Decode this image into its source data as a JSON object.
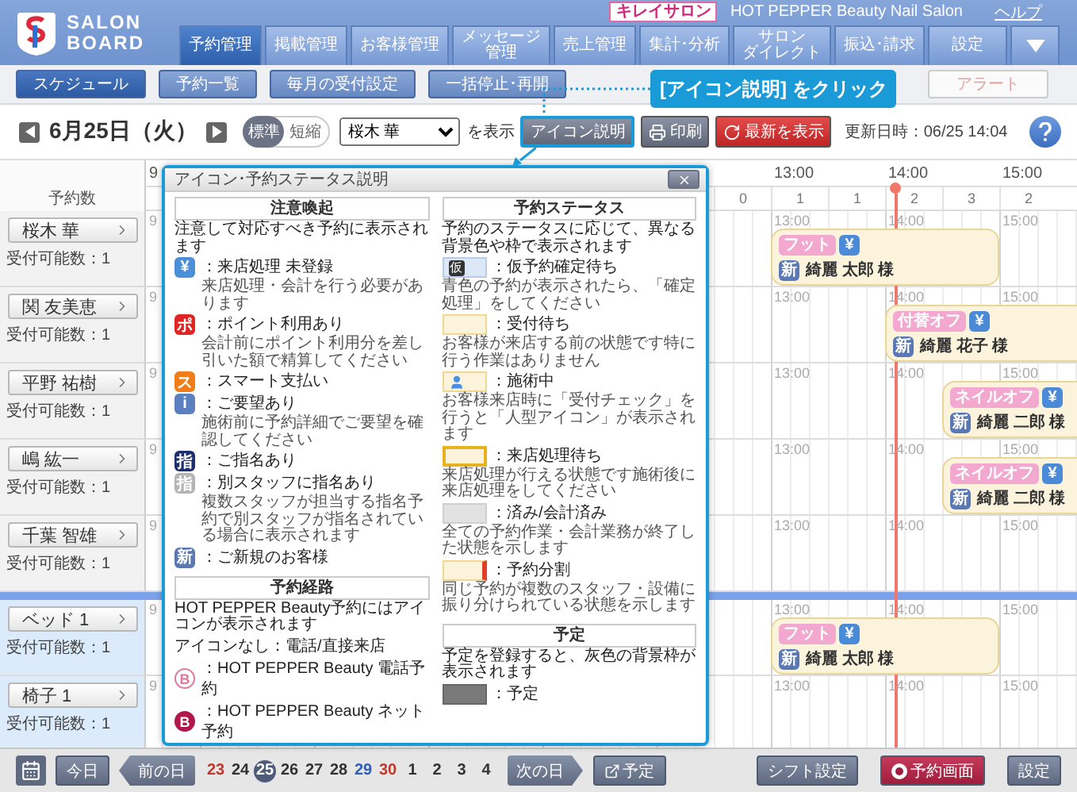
{
  "header": {
    "logo": {
      "line1": "SALON",
      "line2": "BOARD"
    },
    "site_badge": "キレイサロン",
    "salon_name": "HOT PEPPER Beauty Nail Salon",
    "help_link": "ヘルプ",
    "tabs": [
      {
        "lines": [
          "予約管理"
        ],
        "selected": true
      },
      {
        "lines": [
          "掲載管理"
        ],
        "selected": false
      },
      {
        "lines": [
          "お客様管理"
        ],
        "selected": false
      },
      {
        "lines": [
          "メッセージ",
          "管理"
        ],
        "selected": false
      },
      {
        "lines": [
          "売上管理"
        ],
        "selected": false
      },
      {
        "lines": [
          "集計･分析"
        ],
        "selected": false
      },
      {
        "lines": [
          "サロン",
          "ダイレクト"
        ],
        "selected": false
      },
      {
        "lines": [
          "振込･請求"
        ],
        "selected": false
      },
      {
        "lines": [
          "設定"
        ],
        "selected": false
      }
    ]
  },
  "subnav": {
    "buttons": [
      {
        "label": "スケジュール",
        "selected": true
      },
      {
        "label": "予約一覧",
        "selected": false
      },
      {
        "label": "毎月の受付設定",
        "selected": false
      },
      {
        "label": "一括停止･再開",
        "selected": false
      }
    ],
    "alert_button": {
      "label": "アラート",
      "disabled": true
    }
  },
  "callout": {
    "text": "[アイコン説明] をクリック"
  },
  "toolbar": {
    "date": "6月25日（火）",
    "view_toggle": [
      {
        "label": "標準",
        "selected": true
      },
      {
        "label": "短縮",
        "selected": false
      }
    ],
    "staff_select": "桜木 華",
    "select_suffix": "を表示",
    "buttons": [
      {
        "label": "アイコン説明",
        "kind": "legend",
        "highlighted": true
      },
      {
        "label": "印刷",
        "kind": "print",
        "highlighted": false
      },
      {
        "label": "最新を表示",
        "kind": "refresh",
        "highlighted": false
      }
    ],
    "updated": "更新日時：06/25 14:04"
  },
  "schedule": {
    "count_header": "予約数",
    "time_labels": [
      "9",
      "13:00",
      "14:00",
      "15:00"
    ],
    "slot_counts": [
      "0",
      "1",
      "1",
      "2",
      "3",
      "2"
    ],
    "now_marker": {
      "kind": "five_past_two"
    },
    "rows": [
      {
        "name": "桜木 華",
        "kind": "staff",
        "capacity": "受付可能数：1",
        "time_labels": [
          "9",
          "13:00",
          "14:00",
          "15:00"
        ],
        "bookings": [
          {
            "kind": "one_to_three",
            "menu": "フット",
            "payment_badge": "¥",
            "new_badge": "新",
            "customer": "綺麗 太郎 様"
          }
        ]
      },
      {
        "name": "関 友美恵",
        "kind": "staff",
        "capacity": "受付可能数：1",
        "time_labels": [
          "9",
          "13:00",
          "14:00",
          "15:00"
        ],
        "bookings": [
          {
            "kind": "two_to_four",
            "menu": "付替オフ",
            "payment_badge": "¥",
            "new_badge": "新",
            "customer": "綺麗 花子 様"
          }
        ]
      },
      {
        "name": "平野 祐樹",
        "kind": "staff",
        "capacity": "受付可能数：1",
        "time_labels": [
          "9",
          "13:00",
          "14:00",
          "15:00"
        ],
        "bookings": [
          {
            "kind": "half_two_to_four",
            "menu": "ネイルオフ",
            "payment_badge": "¥",
            "new_badge": "新",
            "customer": "綺麗 二郎 様"
          }
        ]
      },
      {
        "name": "嶋 紘一",
        "kind": "staff",
        "capacity": "受付可能数：1",
        "time_labels": [
          "9",
          "13:00",
          "14:00",
          "15:00"
        ],
        "bookings": [
          {
            "kind": "half_two_to_four",
            "menu": "ネイルオフ",
            "payment_badge": "¥",
            "new_badge": "新",
            "customer": "綺麗 二郎 様"
          }
        ]
      },
      {
        "name": "千葉 智雄",
        "kind": "staff",
        "capacity": "受付可能数：1",
        "time_labels": [
          "9",
          "13:00",
          "14:00",
          "15:00"
        ],
        "bookings": []
      },
      {
        "name": "ベッド 1",
        "kind": "equipment",
        "capacity": "受付可能数：1",
        "time_labels": [
          "9",
          "13:00",
          "14:00",
          "15:00"
        ],
        "bookings": [
          {
            "kind": "one_to_three",
            "menu": "フット",
            "payment_badge": "¥",
            "new_badge": "新",
            "customer": "綺麗 太郎 様"
          }
        ]
      },
      {
        "name": "椅子 1",
        "kind": "equipment",
        "capacity": "受付可能数：1",
        "time_labels": [
          "9",
          "13:00",
          "14:00",
          "15:00"
        ],
        "bookings": []
      }
    ]
  },
  "popup": {
    "title": "アイコン･予約ステータス説明",
    "columns": [
      [
        {
          "heading": "注意喚起",
          "note": "注意して対応すべき予約に表示されます",
          "items": [
            {
              "kind": "icon",
              "icon": "¥",
              "color": "#4a8fd8",
              "label": "：来店処理 未登録",
              "desc": "来店処理・会計を行う必要があります"
            },
            {
              "kind": "icon",
              "icon": "ポ",
              "color": "#e02424",
              "label": "：ポイント利用あり",
              "desc": "会計前にポイント利用分を差し引いた額で精算してください"
            },
            {
              "kind": "icon",
              "icon": "ス",
              "color": "#f07c1a",
              "label": "：スマート支払い"
            },
            {
              "kind": "icon",
              "icon": "i",
              "color": "#5b80c0",
              "label": "：ご要望あり",
              "desc": "施術前に予約詳細でご要望を確認してください"
            },
            {
              "kind": "icon",
              "icon": "指",
              "color": "#1d2f6e",
              "label": "：ご指名あり"
            },
            {
              "kind": "icon",
              "icon": "指",
              "color": "#b5b5b5",
              "label": "：別スタッフに指名あり",
              "desc": "複数スタッフが担当する指名予約で別スタッフが指名されている場合に表示されます"
            },
            {
              "kind": "icon",
              "icon": "新",
              "color": "#5a78b4",
              "label": "：ご新規のお客様"
            }
          ]
        },
        {
          "heading": "予約経路",
          "note": "HOT PEPPER Beauty予約にはアイコンが表示されます",
          "items": [
            {
              "kind": "plain",
              "label": "アイコンなし：電話/直接来店"
            },
            {
              "kind": "route",
              "icon": "B",
              "color": "#e07a9c",
              "outlined": true,
              "label": "：HOT PEPPER Beauty 電話予約"
            },
            {
              "kind": "route",
              "icon": "B",
              "color": "#b0174a",
              "outlined": false,
              "label": "：HOT PEPPER Beauty ネット予約"
            }
          ]
        }
      ],
      [
        {
          "heading": "予約ステータス",
          "note": "予約のステータスに応じて、異なる背景色や枠で表示されます",
          "items": [
            {
              "kind": "tentative",
              "swatch_text": "仮",
              "label": "：仮予約確定待ち",
              "desc": "青色の予約が表示されたら、「確定処理」をしてください"
            },
            {
              "kind": "waiting",
              "label": "：受付待ち",
              "desc": "お客様が来店する前の状態です特に行う作業はありません"
            },
            {
              "kind": "in_service",
              "label": "：施術中",
              "desc": "お客様来店時に「受付チェック」を行うと「人型アイコン」が表示されます"
            },
            {
              "kind": "checkin_wait",
              "label": "：来店処理待ち",
              "desc": "来店処理が行える状態です施術後に来店処理をしてください"
            },
            {
              "kind": "done",
              "label": "：済み/会計済み",
              "desc": "全ての予約作業・会計業務が終了した状態を示します"
            },
            {
              "kind": "split",
              "label": "：予約分割",
              "desc": "同じ予約が複数のスタッフ・設備に振り分けられている状態を示します"
            }
          ]
        },
        {
          "heading": "予定",
          "note": "予定を登録すると、灰色の背景枠が表示されます",
          "items": [
            {
              "kind": "plan",
              "label": "：予定"
            }
          ]
        }
      ]
    ]
  },
  "bottom_bar": {
    "today": "今日",
    "prev": "前の日",
    "next": "次の日",
    "plan": "予定",
    "dates": [
      {
        "label": "23",
        "color": "#c0392b",
        "selected": false
      },
      {
        "label": "24",
        "color": "#333333",
        "selected": false
      },
      {
        "label": "25",
        "selected": true
      },
      {
        "label": "26",
        "color": "#333333",
        "selected": false
      },
      {
        "label": "27",
        "color": "#333333",
        "selected": false
      },
      {
        "label": "28",
        "color": "#333333",
        "selected": false
      },
      {
        "label": "29",
        "color": "#2d5fb8",
        "selected": false
      },
      {
        "label": "30",
        "color": "#c0392b",
        "selected": false
      },
      {
        "label": "1",
        "color": "#333333",
        "selected": false
      },
      {
        "label": "2",
        "color": "#333333",
        "selected": false
      },
      {
        "label": "3",
        "color": "#333333",
        "selected": false
      },
      {
        "label": "4",
        "color": "#333333",
        "selected": false
      }
    ],
    "right_buttons": [
      {
        "label": "シフト設定",
        "kind": "plain"
      },
      {
        "label": "予約画面",
        "kind": "brand"
      },
      {
        "label": "設定",
        "kind": "plain"
      }
    ]
  }
}
